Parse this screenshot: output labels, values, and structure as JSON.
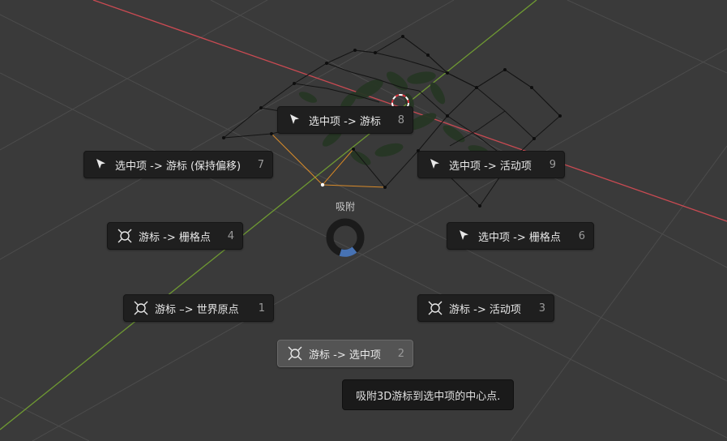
{
  "pie": {
    "title": "吸附",
    "items": [
      {
        "name": "selection-to-cursor-button",
        "icon": "cursor-arrow-icon",
        "label": "选中项 -> 游标",
        "key": "8"
      },
      {
        "name": "selection-to-cursor-offset-button",
        "icon": "cursor-arrow-icon",
        "label": "选中项 -> 游标 (保持偏移)",
        "key": "7"
      },
      {
        "name": "selection-to-active-button",
        "icon": "cursor-arrow-icon",
        "label": "选中项 -> 活动项",
        "key": "9"
      },
      {
        "name": "cursor-to-grid-button",
        "icon": "cursor-3d-icon",
        "label": "游标 -> 栅格点",
        "key": "4"
      },
      {
        "name": "selection-to-grid-button",
        "icon": "cursor-arrow-icon",
        "label": "选中项 -> 栅格点",
        "key": "6"
      },
      {
        "name": "cursor-to-world-origin-button",
        "icon": "cursor-3d-icon",
        "label": "游标 –> 世界原点",
        "key": "1"
      },
      {
        "name": "cursor-to-active-button",
        "icon": "cursor-3d-icon",
        "label": "游标 -> 活动项",
        "key": "3"
      },
      {
        "name": "cursor-to-selected-button",
        "icon": "cursor-3d-icon",
        "label": "游标 -> 选中项",
        "key": "2"
      }
    ]
  },
  "tooltip": {
    "text": "吸附3D游标到选中项的中心点."
  },
  "colors": {
    "x_axis": "#c94a52",
    "y_axis": "#6f9a32",
    "pie_accent": "#4772b3",
    "grid": "#555555"
  }
}
